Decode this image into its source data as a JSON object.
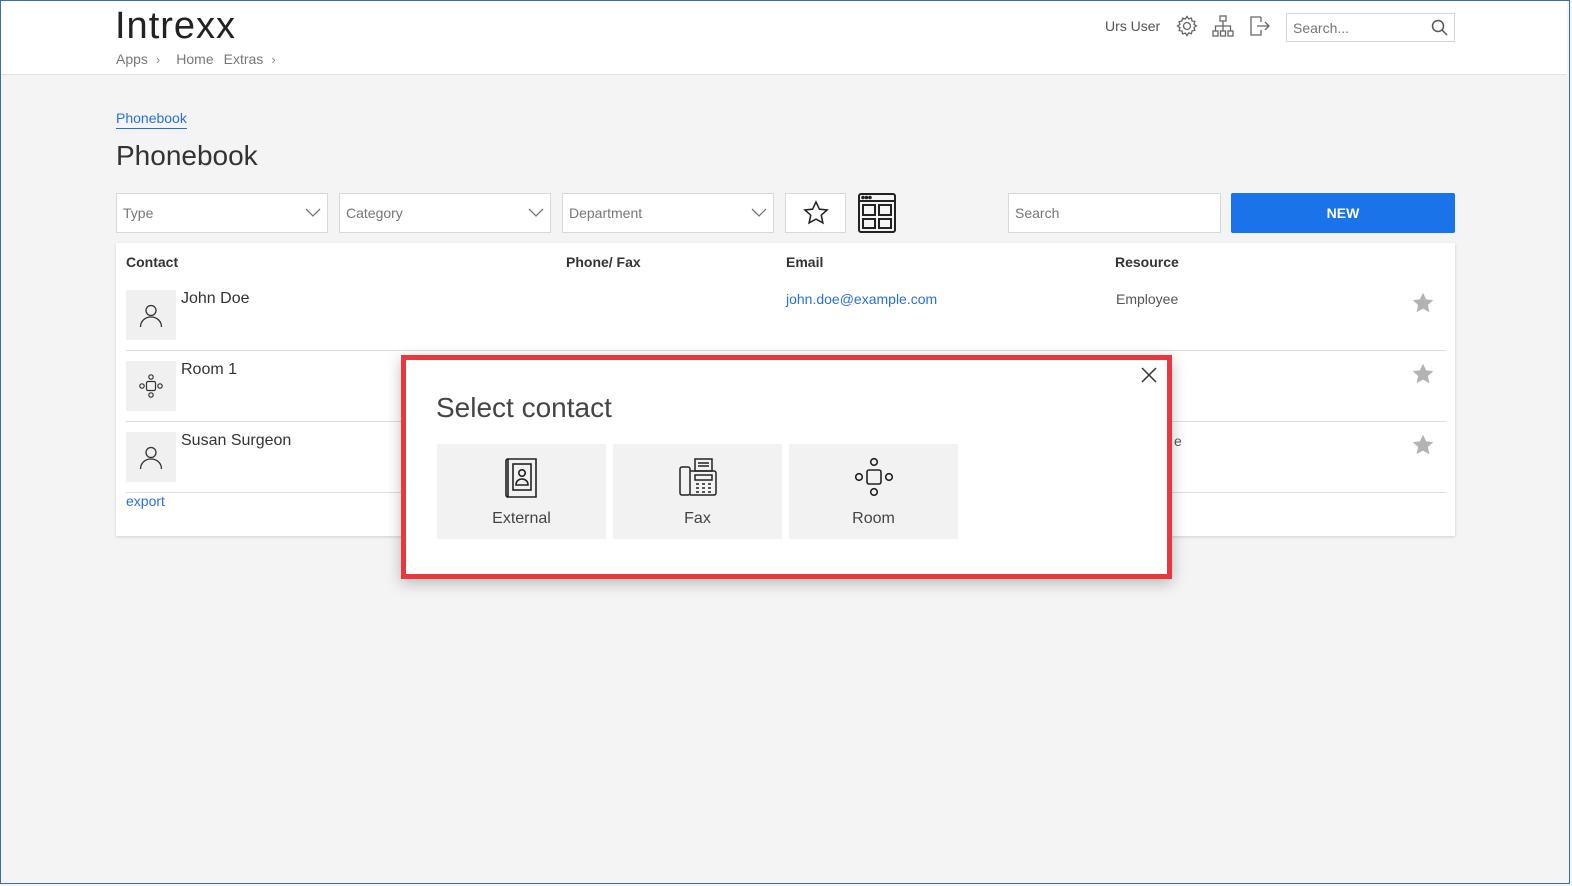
{
  "header": {
    "logo": "Intrexx",
    "breadcrumbs": [
      "Apps",
      "Home",
      "Extras"
    ],
    "user": "Urs User",
    "search_placeholder": "Search..."
  },
  "page": {
    "link": "Phonebook",
    "title": "Phonebook"
  },
  "filters": {
    "type": "Type",
    "category": "Category",
    "department": "Department",
    "search_placeholder": "Search",
    "new_label": "NEW"
  },
  "table": {
    "columns": [
      "Contact",
      "Phone/ Fax",
      "Email",
      "Resource"
    ],
    "rows": [
      {
        "name": "John Doe",
        "email": "john.doe@example.com",
        "resource": "Employee",
        "icon": "person-icon"
      },
      {
        "name": "Room 1",
        "email": "",
        "resource": "",
        "icon": "room-icon"
      },
      {
        "name": "Susan Surgeon",
        "email": "",
        "resource": "e",
        "icon": "person-icon"
      }
    ],
    "export": "export"
  },
  "modal": {
    "title": "Select contact",
    "options": [
      {
        "label": "External",
        "icon": "contact-book-icon"
      },
      {
        "label": "Fax",
        "icon": "fax-icon"
      },
      {
        "label": "Room",
        "icon": "room-icon"
      }
    ]
  },
  "colors": {
    "accent": "#1a73e8",
    "link": "#2a6fdb",
    "highlight": "#e8383d"
  }
}
